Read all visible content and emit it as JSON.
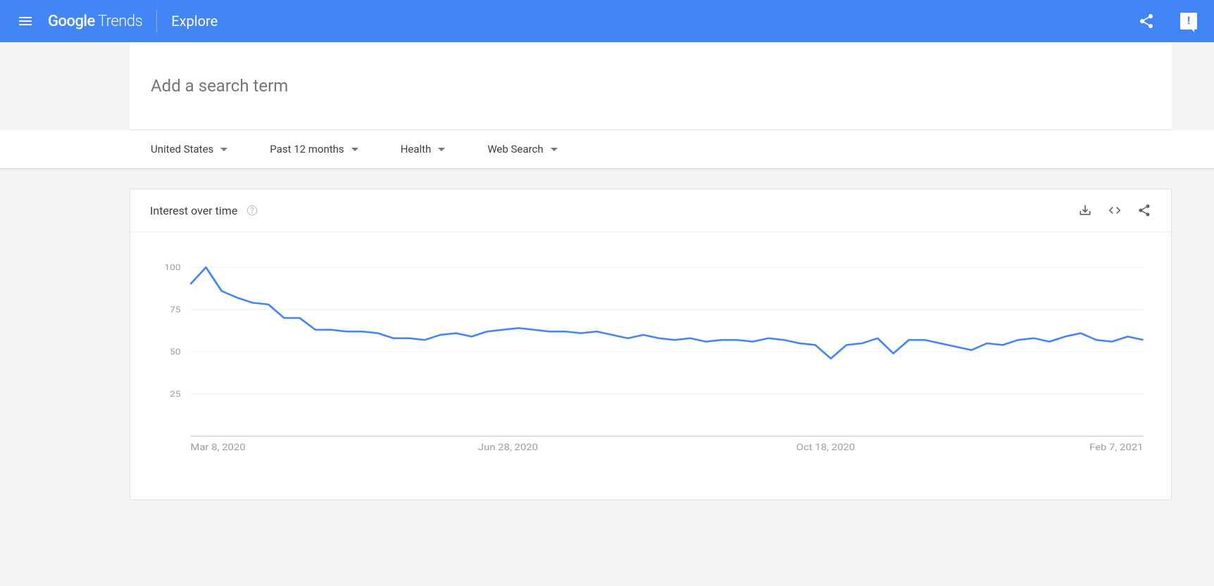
{
  "header": {
    "logo_google": "Google",
    "logo_trends": "Trends",
    "title": "Explore"
  },
  "search": {
    "placeholder": "Add a search term"
  },
  "filters": {
    "region": "United States",
    "time": "Past 12 months",
    "category": "Health",
    "search_type": "Web Search"
  },
  "chart": {
    "title": "Interest over time",
    "y_ticks": [
      "100",
      "75",
      "50",
      "25"
    ],
    "x_ticks": [
      "Mar 8, 2020",
      "Jun 28, 2020",
      "Oct 18, 2020",
      "Feb 7, 2021"
    ]
  },
  "chart_data": {
    "type": "line",
    "title": "Interest over time",
    "xlabel": "",
    "ylabel": "",
    "ylim": [
      0,
      100
    ],
    "x_tick_labels": [
      "Mar 8, 2020",
      "Jun 28, 2020",
      "Oct 18, 2020",
      "Feb 7, 2021"
    ],
    "series": [
      {
        "name": "Health",
        "color": "#4285f4",
        "values": [
          90,
          100,
          86,
          82,
          79,
          78,
          70,
          70,
          63,
          63,
          62,
          62,
          61,
          58,
          58,
          57,
          60,
          61,
          59,
          62,
          63,
          64,
          63,
          62,
          62,
          61,
          62,
          60,
          58,
          60,
          58,
          57,
          58,
          56,
          57,
          57,
          56,
          58,
          57,
          55,
          54,
          46,
          54,
          55,
          58,
          49,
          57,
          57,
          55,
          53,
          51,
          55,
          54,
          57,
          58,
          56,
          59,
          61,
          57,
          56,
          59,
          57
        ]
      }
    ]
  }
}
